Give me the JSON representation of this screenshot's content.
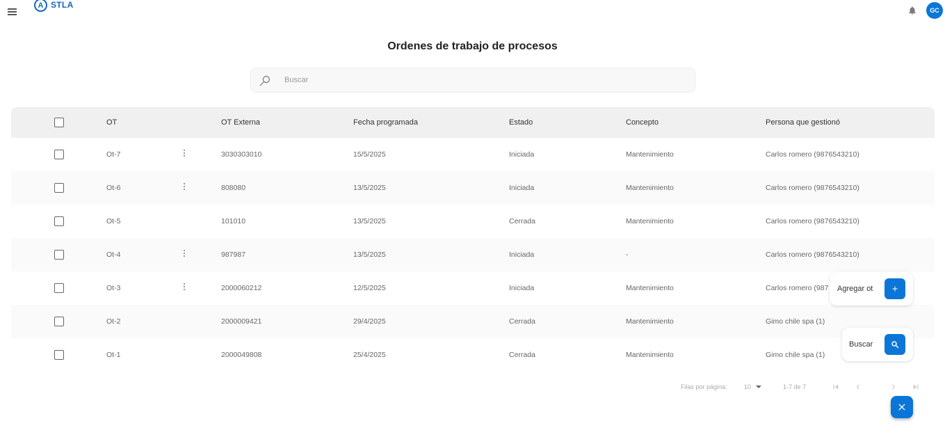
{
  "app": {
    "brand": "STLA",
    "avatar_initials": "GC"
  },
  "icons": {
    "menu": "menu-icon",
    "bell": "bell-icon",
    "search": "search-icon",
    "add": "plus-icon",
    "close": "close-icon",
    "more": "more-vert-icon"
  },
  "colors": {
    "primary": "#0b76d8",
    "brand": "#1565c0"
  },
  "page": {
    "title": "Ordenes de trabajo de procesos"
  },
  "search": {
    "placeholder": "Buscar",
    "value": ""
  },
  "table": {
    "columns": [
      "OT",
      "OT Externa",
      "Fecha programada",
      "Estado",
      "Concepto",
      "Persona que gestionó"
    ],
    "rows": [
      {
        "ot": "Ot-7",
        "has_menu": true,
        "ot_externa": "3030303010",
        "fecha": "15/5/2025",
        "estado": "Iniciada",
        "concepto": "Mantenimiento",
        "persona": "Carlos romero  (9876543210)"
      },
      {
        "ot": "Ot-6",
        "has_menu": true,
        "ot_externa": "808080",
        "fecha": "13/5/2025",
        "estado": "Iniciada",
        "concepto": "Mantenimiento",
        "persona": "Carlos romero  (9876543210)"
      },
      {
        "ot": "Ot-5",
        "has_menu": false,
        "ot_externa": "101010",
        "fecha": "13/5/2025",
        "estado": "Cerrada",
        "concepto": "Mantenimiento",
        "persona": "Carlos romero  (9876543210)"
      },
      {
        "ot": "Ot-4",
        "has_menu": true,
        "ot_externa": "987987",
        "fecha": "13/5/2025",
        "estado": "Iniciada",
        "concepto": "-",
        "persona": "Carlos romero  (9876543210)"
      },
      {
        "ot": "Ot-3",
        "has_menu": true,
        "ot_externa": "2000060212",
        "fecha": "12/5/2025",
        "estado": "Iniciada",
        "concepto": "Mantenimiento",
        "persona": "Carlos romero  (987"
      },
      {
        "ot": "Ot-2",
        "has_menu": false,
        "ot_externa": "2000009421",
        "fecha": "29/4/2025",
        "estado": "Cerrada",
        "concepto": "Mantenimiento",
        "persona": "Gimo chile spa (1)"
      },
      {
        "ot": "Ot-1",
        "has_menu": false,
        "ot_externa": "2000049808",
        "fecha": "25/4/2025",
        "estado": "Cerrada",
        "concepto": "Mantenimiento",
        "persona": "Gimo chile spa (1)"
      }
    ]
  },
  "pagination": {
    "rows_label": "Filas por página:",
    "rows_per_page": "10",
    "range": "1-7 de 7"
  },
  "speed_dial": {
    "add_label": "Agregar ot",
    "search_label": "Buscar"
  }
}
